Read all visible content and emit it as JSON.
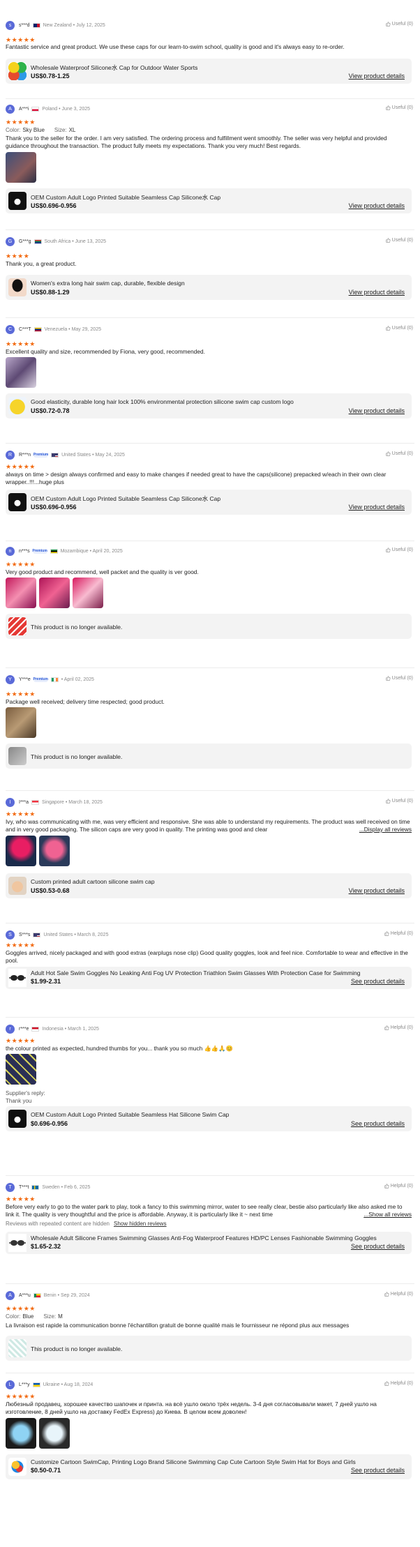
{
  "reviews": [
    {
      "avatar": "s",
      "name": "s***d",
      "country": "New Zealand",
      "date": "July 12, 2025",
      "flag": [
        "#012169",
        "#c8102e"
      ],
      "useful": "Useful (0)",
      "stars": "★★★★★",
      "text": "Fantastic service and great product. We use these caps for our learn-to-swim school, quality is good and it's always easy to re-order.",
      "product": {
        "title": "Wholesale Waterproof Silicone水 Cap for Outdoor Water Sports",
        "price": "US$0.78-1.25",
        "link": "View product details",
        "img": "multi-color"
      }
    },
    {
      "avatar": "A",
      "name": "A***i",
      "country": "Poland",
      "date": "June 3, 2025",
      "flag": [
        "#ffffff",
        "#dc143c"
      ],
      "useful": "Useful (0)",
      "stars": "★★★★★",
      "color_label": "Color:",
      "color_value": "Sky Blue",
      "size_label": "Size:",
      "size_value": "XL",
      "text": "Thank you to the seller for the order. I am very satisfied. The ordering process and fulfillment went smoothly. The seller was very helpful and provided guidance throughout the transaction. The product fully meets my expectations. Thank you very much! Best regards.",
      "product": {
        "title": "OEM Custom Adult Logo Printed Suitable Seamless Cap Silicone水 Cap",
        "price": "US$0.696-0.956",
        "link": "View product details",
        "img": "dark"
      }
    },
    {
      "avatar": "G",
      "name": "G***g",
      "country": "South Africa",
      "date": "June 13, 2025",
      "flag": [
        "#007a4d",
        "#de3831"
      ],
      "useful": "Useful (0)",
      "stars": "★★★★",
      "text": "Thank you, a great product.",
      "product": {
        "title": "Women's extra long hair swim cap, durable, flexible design",
        "price": "US$0.88-1.29",
        "link": "View product details",
        "img": "black"
      }
    },
    {
      "avatar": "C",
      "name": "C***T",
      "country": "Venezuela",
      "date": "May 29, 2025",
      "flag": [
        "#ffcc00",
        "#cf142b"
      ],
      "useful": "Useful (0)",
      "stars": "★★★★★",
      "text": "Excellent quality and size, recommended by Fiona, very good, recommended.",
      "product": {
        "title": "Good elasticity, durable long hair lock 100% environmental protection silicone swim cap custom logo",
        "price": "US$0.72-0.78",
        "link": "View product details",
        "img": "yellow"
      }
    },
    {
      "avatar": "R",
      "name": "R***n",
      "badge": "Premium",
      "country": "United States",
      "date": "May 24, 2025",
      "flag": [
        "#3c3b6e",
        "#b22234"
      ],
      "useful": "Useful (0)",
      "stars": "★★★★★",
      "text": "always on time > design always confirmed and easy to make changes if needed great to have the caps(silicone) prepacked w/each in their own clear wrapper..!!!...huge plus",
      "product": {
        "title": "OEM Custom Adult Logo Printed Suitable Seamless Cap Silicone水 Cap",
        "price": "US$0.696-0.956",
        "link": "View product details",
        "img": "dark"
      }
    },
    {
      "avatar": "n",
      "name": "n***s",
      "badge": "Premium",
      "country": "Mozambique",
      "date": "April 20, 2025",
      "flag": [
        "#009a44",
        "#000000"
      ],
      "useful": "Useful (0)",
      "stars": "★★★★★",
      "text": "Very good product and recommend, well packet and the quality is ver good.",
      "unavailable": "This product is no longer available."
    },
    {
      "avatar": "Y",
      "name": "Y***e",
      "badge": "Premium",
      "country": "",
      "date": "April 02, 2025",
      "flag": [
        "#169b62",
        "#ff883e"
      ],
      "useful": "Useful (0)",
      "stars": "★★★★★",
      "text": "Package well received; delivery time respected; good product.",
      "unavailable": "This product is no longer available."
    },
    {
      "avatar": "I",
      "name": "I***a",
      "country": "Singapore",
      "date": "March 18, 2025",
      "flag": [
        "#ef3340",
        "#ffffff"
      ],
      "useful": "Useful (0)",
      "stars": "★★★★★",
      "text": "Ivy, who was communicating with me, was very efficient and responsive. She was able to understand my requirements. The product was well received on time and in very good packaging. The silicon caps are very good in quality. The printing was good and clear",
      "more": "...Display all reviews",
      "product": {
        "title": "Custom printed adult cartoon silicone swim cap",
        "price": "US$0.53-0.68",
        "link": "View product details",
        "img": "cartoon"
      }
    },
    {
      "avatar": "S",
      "name": "S***s",
      "country": "United States",
      "date": "March 8, 2025",
      "flag": [
        "#3c3b6e",
        "#b22234"
      ],
      "useful": "Helpful (0)",
      "stars": "★★★★★",
      "text": "Goggles arrived, nicely packaged and with good extras (earplugs nose clip) Good quality goggles, look and feel nice. Comfortable to wear and effective in the pool.",
      "product": {
        "title": "Adult Hot Sale Swim Goggles No Leaking Anti Fog UV Protection Triathlon Swim Glasses With Protection Case for Swimming",
        "price": "$1.99-2.31",
        "link": "See product details",
        "img": "goggles"
      }
    },
    {
      "avatar": "r",
      "name": "r***e",
      "country": "Indonesia",
      "date": "March 1, 2025",
      "flag": [
        "#ce1126",
        "#ffffff"
      ],
      "useful": "Helpful (0)",
      "stars": "★★★★★",
      "text": "the colour printed as expected, hundred thumbs for you... thank you so much 👍👍🙏😊",
      "reply_label": "Supplier's reply:",
      "reply_text": "Thank you",
      "product": {
        "title": "OEM Custom Adult Logo Printed Suitable Seamless Hat Silicone Swim Cap",
        "price": "$0.696-0.956",
        "link": "See product details",
        "img": "dark"
      }
    },
    {
      "avatar": "T",
      "name": "T***t",
      "country": "Sweden",
      "date": "Feb 6, 2025",
      "flag": [
        "#006aa7",
        "#fecc00"
      ],
      "useful": "Helpful (0)",
      "stars": "★★★★★",
      "text": "Before very early to go to the water park to play, took a fancy to this swimming mirror, water to see really clear, bestie also particularly like also asked me to link it. The quality is very thoughtful and the price is affordable. Anyway, it is particularly like it ~ next time",
      "more": "...Show all reviews",
      "hidden_note": "Reviews with repeated content are hidden",
      "hidden_link": "Show hidden reviews",
      "product": {
        "title": "Wholesale Adult Silicone Frames Swimming Glasses Anti-Fog Waterproof Features HD/PC Lenses Fashionable Swimming Goggles",
        "price": "$1.65-2.32",
        "link": "See product details",
        "img": "goggles"
      }
    },
    {
      "avatar": "A",
      "name": "A***u",
      "country": "Benin",
      "date": "Sep 29, 2024",
      "flag": [
        "#008751",
        "#fcd116"
      ],
      "useful": "Helpful (0)",
      "stars": "★★★★★",
      "color_label": "Color:",
      "color_value": "Blue",
      "size_label": "Size:",
      "size_value": "M",
      "text": "La livraison est rapide la communication bonne l'échantillon gratuit de bonne qualité mais le fournisseur ne répond plus aux messages",
      "unavailable": "This product is no longer available."
    },
    {
      "avatar": "L",
      "name": "L***y",
      "country": "Ukraine",
      "date": "Aug 18, 2024",
      "flag": [
        "#0057b7",
        "#ffd700"
      ],
      "useful": "Helpful (0)",
      "stars": "★★★★★",
      "text": "Любезный продавец, хорошее качество шапочек и принта. на всё ушло около трёх недель. 3-4 дня согласовывали макет, 7 дней ушло на изготовление, 8 дней ушло на доставку FedEx Express) до Киева. В целом всем доволен!",
      "product": {
        "title": "Customize Cartoon SwimCap, Printing Logo Brand Silicone Swimming Cap Cute Cartoon Style Swim Hat for Boys and Girls",
        "price": "$0.50-0.71",
        "link": "See product details",
        "img": "cartoon"
      }
    }
  ],
  "colors": {
    "star": "#f26b12",
    "avatar": "#5a6ad8",
    "card": "#f3f3f3"
  }
}
